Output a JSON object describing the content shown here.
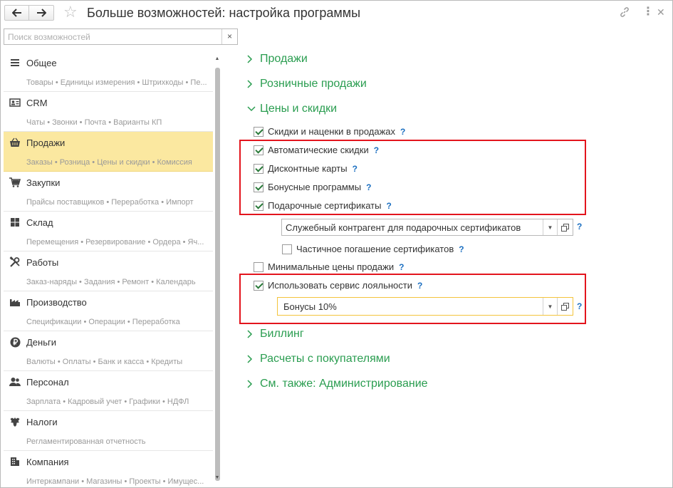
{
  "window": {
    "title": "Больше возможностей: настройка программы"
  },
  "search": {
    "placeholder": "Поиск возможностей",
    "clear": "×"
  },
  "sidebar": {
    "items": [
      {
        "icon": "list-icon",
        "title": "Общее",
        "sub": "Товары • Единицы измерения • Штрихкоды • Пе...",
        "selected": false
      },
      {
        "icon": "crm-card-icon",
        "title": "CRM",
        "sub": "Чаты • Звонки • Почта • Варианты КП",
        "selected": false
      },
      {
        "icon": "basket-icon",
        "title": "Продажи",
        "sub": "Заказы • Розница • Цены и скидки • Комиссия",
        "selected": true
      },
      {
        "icon": "cart-icon",
        "title": "Закупки",
        "sub": "Прайсы поставщиков • Переработка • Импорт",
        "selected": false
      },
      {
        "icon": "warehouse-icon",
        "title": "Склад",
        "sub": "Перемещения • Резервирование • Ордера • Яч...",
        "selected": false
      },
      {
        "icon": "tools-icon",
        "title": "Работы",
        "sub": "Заказ-наряды • Задания • Ремонт • Календарь",
        "selected": false
      },
      {
        "icon": "factory-icon",
        "title": "Производство",
        "sub": "Спецификации • Операции • Переработка",
        "selected": false
      },
      {
        "icon": "ruble-coin-icon",
        "title": "Деньги",
        "sub": "Валюты • Оплаты • Банк и касса • Кредиты",
        "selected": false
      },
      {
        "icon": "people-icon",
        "title": "Персонал",
        "sub": "Зарплата • Кадровый учет • Графики • НДФЛ",
        "selected": false
      },
      {
        "icon": "eagle-emblem-icon",
        "title": "Налоги",
        "sub": "Регламентированная отчетность",
        "selected": false
      },
      {
        "icon": "building-icon",
        "title": "Компания",
        "sub": "Интеркампани • Магазины • Проекты • Имущес...",
        "selected": false
      }
    ]
  },
  "main": {
    "sections": {
      "sales": "Продажи",
      "retail": "Розничные продажи",
      "prices": "Цены и скидки",
      "billing": "Биллинг",
      "settlements": "Расчеты с покупателями",
      "see_also": "См. также: Администрирование"
    },
    "checkboxes": {
      "markups": {
        "label": "Скидки и наценки в продажах",
        "checked": true
      },
      "auto_discounts": {
        "label": "Автоматические скидки",
        "checked": true
      },
      "discount_cards": {
        "label": "Дисконтные карты",
        "checked": true
      },
      "bonus_programs": {
        "label": "Бонусные программы",
        "checked": true
      },
      "gift_certificates": {
        "label": "Подарочные сертификаты",
        "checked": true
      },
      "partial_redemption": {
        "label": "Частичное погашение сертификатов",
        "checked": false
      },
      "min_prices": {
        "label": "Минимальные цены продажи",
        "checked": false
      },
      "loyalty_service": {
        "label": "Использовать сервис лояльности",
        "checked": true
      }
    },
    "fields": {
      "cert_counterparty": "Служебный контрагент для подарочных сертификатов",
      "loyalty_bonus": "Бонусы 10%"
    },
    "help": "?"
  },
  "colors": {
    "accent_green": "#2a9d50",
    "highlight_red": "#e3141d",
    "selection_yellow": "#fbe8a0",
    "help_blue": "#1b6fc1"
  }
}
